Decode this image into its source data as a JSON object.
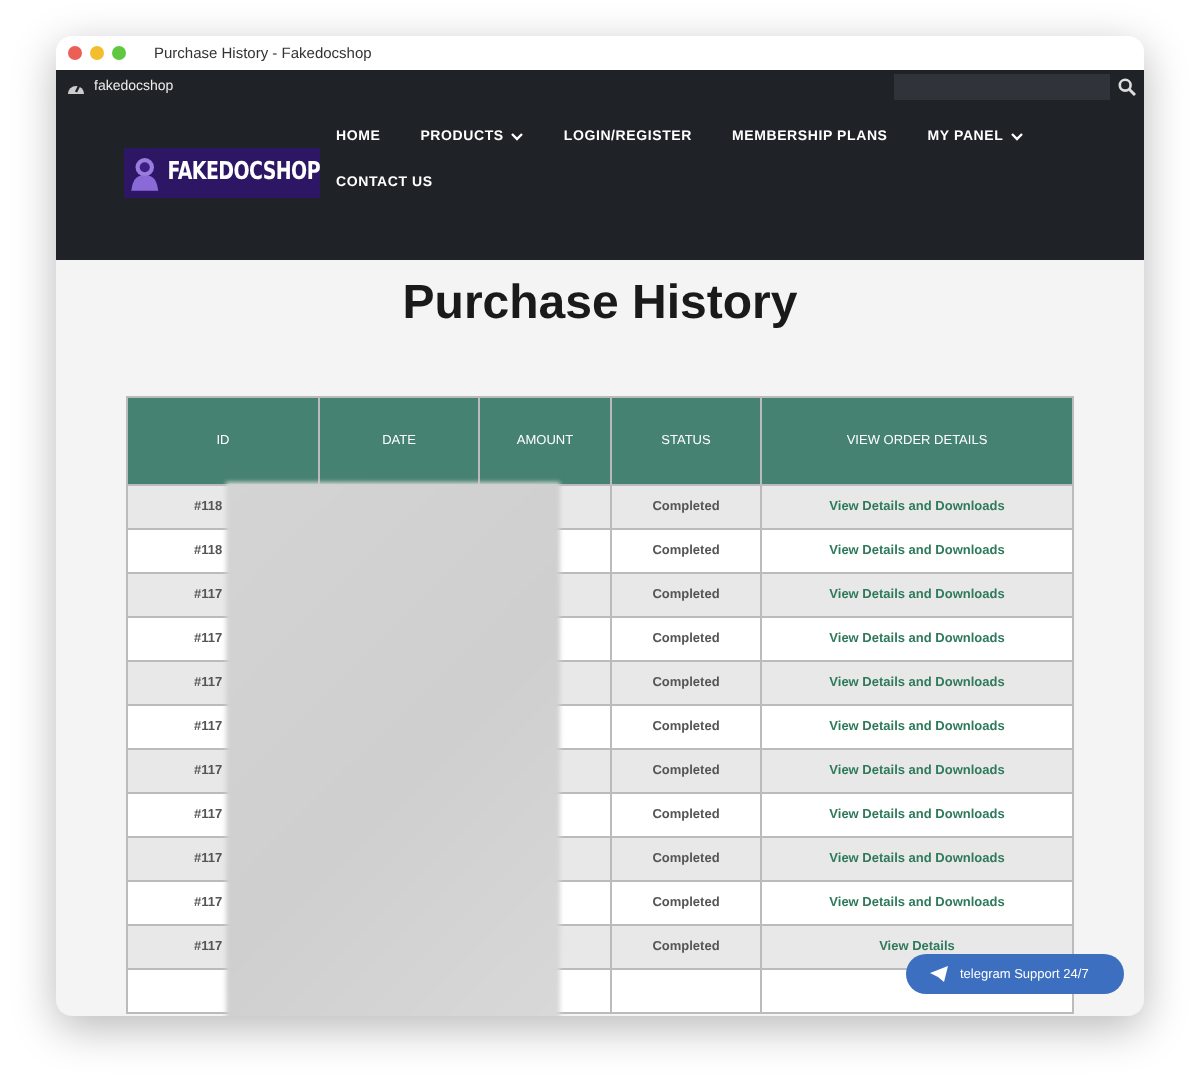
{
  "window": {
    "title": "Purchase History - Fakedocshop"
  },
  "top_bar": {
    "site_name": "fakedocshop"
  },
  "nav": {
    "logo": "FAKEDOCSHOP",
    "items": [
      {
        "label": "HOME",
        "dropdown": false
      },
      {
        "label": "PRODUCTS",
        "dropdown": true
      },
      {
        "label": "LOGIN/REGISTER",
        "dropdown": false
      },
      {
        "label": "MEMBERSHIP PLANS",
        "dropdown": false
      },
      {
        "label": "MY PANEL",
        "dropdown": true
      },
      {
        "label": "CONTACT US",
        "dropdown": false
      }
    ]
  },
  "page_title": "Purchase History",
  "table": {
    "columns": [
      "ID",
      "DATE",
      "AMOUNT",
      "STATUS",
      "VIEW ORDER DETAILS"
    ],
    "rows": [
      {
        "id": "#118",
        "status": "Completed",
        "link": "View Details and Downloads"
      },
      {
        "id": "#118",
        "status": "Completed",
        "link": "View Details and Downloads"
      },
      {
        "id": "#117",
        "status": "Completed",
        "link": "View Details and Downloads"
      },
      {
        "id": "#117",
        "status": "Completed",
        "link": "View Details and Downloads"
      },
      {
        "id": "#117",
        "status": "Completed",
        "link": "View Details and Downloads"
      },
      {
        "id": "#117",
        "status": "Completed",
        "link": "View Details and Downloads"
      },
      {
        "id": "#117",
        "status": "Completed",
        "link": "View Details and Downloads"
      },
      {
        "id": "#117",
        "status": "Completed",
        "link": "View Details and Downloads"
      },
      {
        "id": "#117",
        "status": "Completed",
        "link": "View Details and Downloads"
      },
      {
        "id": "#117",
        "status": "Completed",
        "link": "View Details and Downloads"
      },
      {
        "id": "#117",
        "status": "Completed",
        "link": "View Details"
      }
    ]
  },
  "support_button": {
    "label": "telegram Support 24/7"
  }
}
